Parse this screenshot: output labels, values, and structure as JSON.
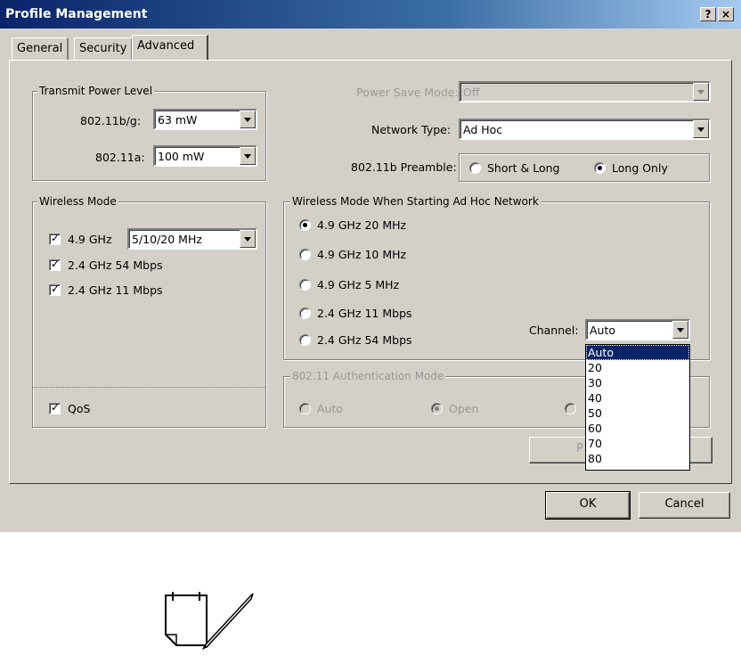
{
  "window": {
    "title": "Profile Management",
    "help_button": "?",
    "close_button": "×"
  },
  "tabs": [
    {
      "label": "General"
    },
    {
      "label": "Security"
    },
    {
      "label": "Advanced"
    }
  ],
  "transmit_power": {
    "legend": "Transmit Power Level",
    "bg_label": "802.11b/g:",
    "bg_value": "63 mW",
    "a_label": "802.11a:",
    "a_value": "100 mW"
  },
  "power_save": {
    "label": "Power Save Mode:",
    "value": "Off"
  },
  "network_type": {
    "label": "Network Type:",
    "value": "Ad Hoc"
  },
  "preamble": {
    "label": "802.11b Preamble:",
    "option1": "Short & Long",
    "option2": "Long Only",
    "selected": "Long Only"
  },
  "wireless_mode": {
    "legend": "Wireless Mode",
    "items": [
      {
        "label": "4.9 GHz",
        "checked": true
      },
      {
        "label": "2.4 GHz 54 Mbps",
        "checked": true
      },
      {
        "label": "2.4 GHz 11 Mbps",
        "checked": true
      }
    ],
    "band_value": "5/10/20 MHz",
    "qos_label": "QoS",
    "qos_checked": true
  },
  "adhoc_mode": {
    "legend": "Wireless Mode When Starting Ad Hoc Network",
    "options": [
      "4.9 GHz 20 MHz",
      "4.9 GHz 10 MHz",
      "4.9 GHz 5 MHz",
      "2.4 GHz 11 Mbps",
      "2.4 GHz 54 Mbps"
    ],
    "selected": "4.9 GHz 20 MHz",
    "channel_label": "Channel:",
    "channel_value": "Auto",
    "channel_options": [
      "Auto",
      "20",
      "30",
      "40",
      "50",
      "60",
      "70",
      "80"
    ],
    "channel_highlighted": "Auto"
  },
  "auth_mode": {
    "legend": "802.11 Authentication Mode",
    "auto": "Auto",
    "open": "Open",
    "selected": "Open",
    "partial_button": "P"
  },
  "buttons": {
    "ok": "OK",
    "cancel": "Cancel"
  },
  "colors": {
    "dialog_bg": "#d4d0c8",
    "titlebar": "#0a246a",
    "selection": "#0a246a"
  },
  "note_icon": "note-pencil-icon"
}
